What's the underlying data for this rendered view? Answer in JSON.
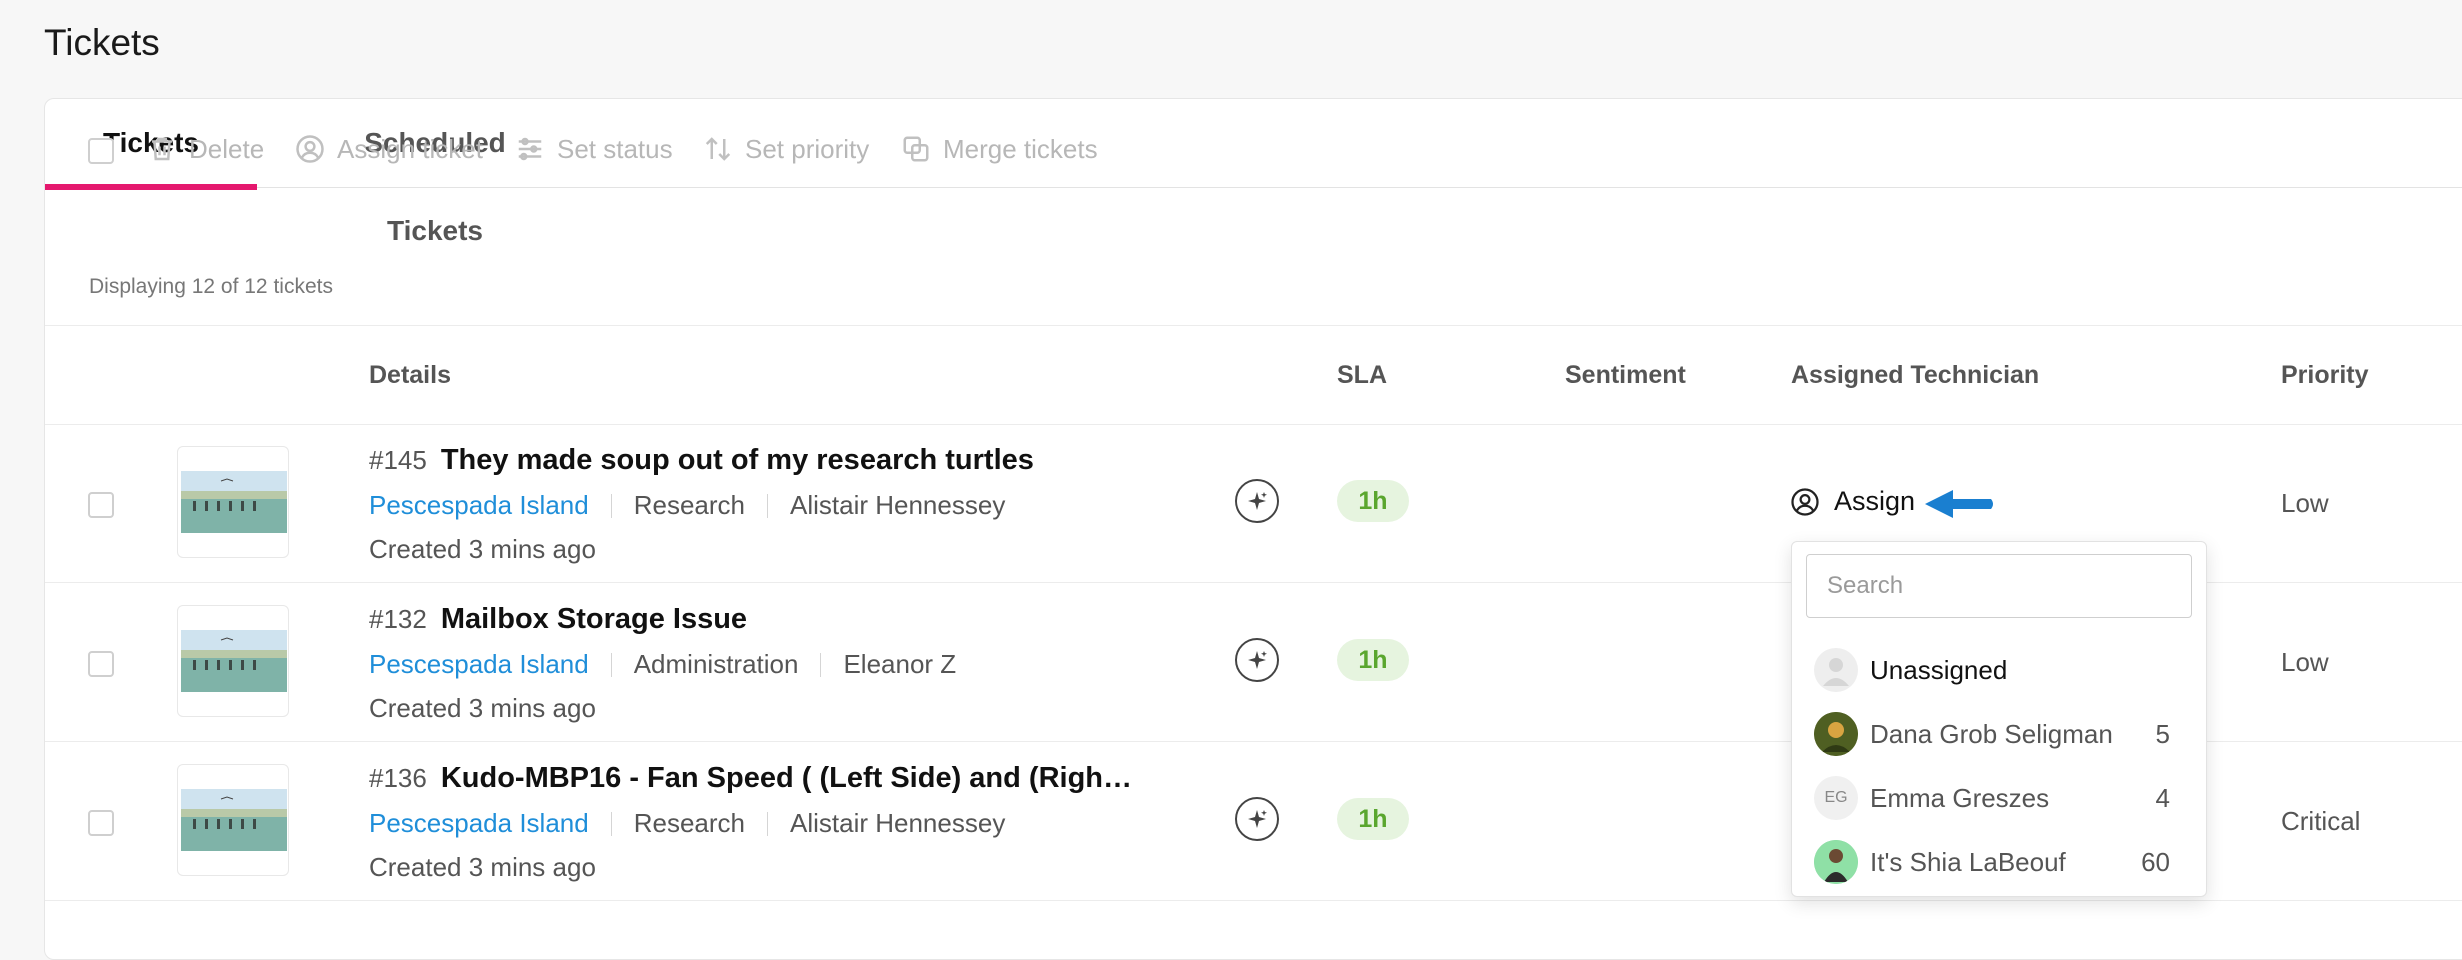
{
  "page": {
    "title": "Tickets"
  },
  "tabs": [
    {
      "label": "Tickets",
      "active": true
    },
    {
      "label": "Scheduled Tickets",
      "active": false
    }
  ],
  "toolbar": {
    "delete": "Delete",
    "assign": "Assign ticket",
    "status": "Set status",
    "priority": "Set priority",
    "merge": "Merge tickets",
    "displaying": "Displaying 12 of 12 tickets"
  },
  "columns": {
    "details": "Details",
    "sla": "SLA",
    "sentiment": "Sentiment",
    "technician": "Assigned Technician",
    "priority": "Priority"
  },
  "tickets": [
    {
      "id": "#145",
      "title": "They made soup out of my research turtles",
      "site": "Pescespada Island",
      "department": "Research",
      "requester": "Alistair Hennessey",
      "created": "Created 3 mins ago",
      "sla": "1h",
      "assign_label": "Assign",
      "priority": "Low"
    },
    {
      "id": "#132",
      "title": "Mailbox Storage Issue",
      "site": "Pescespada Island",
      "department": "Administration",
      "requester": "Eleanor Z",
      "created": "Created 3 mins ago",
      "sla": "1h",
      "priority": "Low"
    },
    {
      "id": "#136",
      "title": "Kudo-MBP16 - Fan Speed ( (Left Side) and (Righ…",
      "site": "Pescespada Island",
      "department": "Research",
      "requester": "Alistair Hennessey",
      "created": "Created 3 mins ago",
      "sla": "1h",
      "priority": "Critical"
    }
  ],
  "assign_dropdown": {
    "search_placeholder": "Search",
    "options": [
      {
        "name": "Unassigned",
        "count": ""
      },
      {
        "name": "Dana Grob Seligman",
        "count": "5"
      },
      {
        "name": "Emma Greszes",
        "initials": "EG",
        "count": "4"
      },
      {
        "name": "It's Shia LaBeouf",
        "count": "60"
      }
    ]
  },
  "colors": {
    "accent": "#e5186e",
    "link": "#1f8ed9",
    "sla_bg": "#e6f4df",
    "sla_text": "#5aa62e",
    "arrow": "#1a7fd0"
  },
  "icons": [
    "trash-icon",
    "user-circle-icon",
    "sliders-icon",
    "sort-arrows-icon",
    "merge-icon",
    "sparkle-icon",
    "arrow-left-icon"
  ]
}
